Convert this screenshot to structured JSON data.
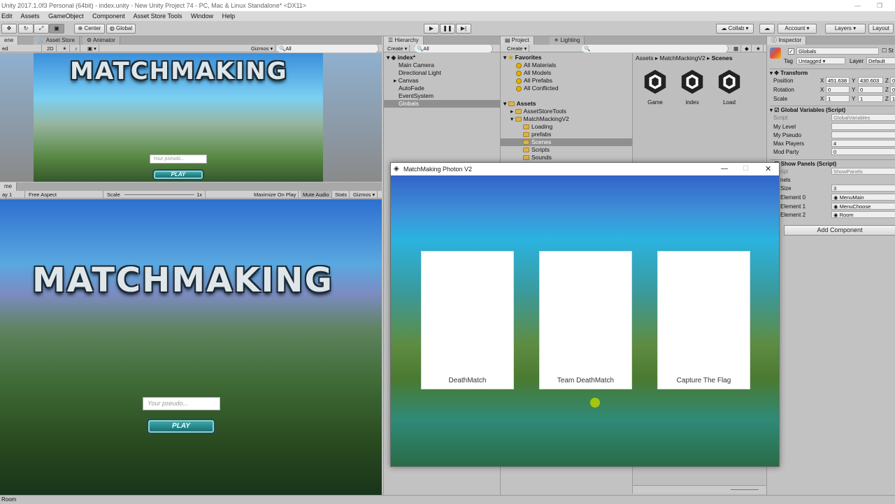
{
  "app_title": "Unity 2017.1.0f3 Personal (64bit) - index.unity - New Unity Project 74 - PC, Mac & Linux Standalone* <DX11>",
  "menu": [
    "Edit",
    "Assets",
    "GameObject",
    "Component",
    "Asset Store Tools",
    "Window",
    "Help"
  ],
  "toolbar": {
    "pivot": "Center",
    "space": "Global",
    "collab": "Collab ▾",
    "account": "Account",
    "layers": "Layers",
    "layout": "Layout"
  },
  "scene_tabs": [
    "ene",
    "Asset Store",
    "Animator"
  ],
  "scene_controls": {
    "shading": "ed",
    "mode": "2D",
    "gizmos": "Gizmos ▾",
    "search": "All"
  },
  "game_tab": "me",
  "game_controls": {
    "display": "ay 1",
    "aspect": "Free Aspect",
    "scale_label": "Scale",
    "scale_value": "1x",
    "maximize": "Maximize On Play",
    "mute": "Mute Audio",
    "stats": "Stats",
    "gizmos": "Gizmos ▾"
  },
  "matchmaking_title": "MATCHMAKING",
  "pseudo_placeholder": "Your pseudo...",
  "play_label": "PLAY",
  "hierarchy": {
    "tab": "Hierarchy",
    "create": "Create ▾",
    "search": "All",
    "scene": "index*",
    "items": [
      "Main Camera",
      "Directional Light",
      "Canvas",
      "AutoFade",
      "EventSystem",
      "Globals"
    ]
  },
  "project": {
    "tab": "Project",
    "tab2": "Lighting",
    "create": "Create ▾",
    "favorites_label": "Favorites",
    "favorites": [
      "All Materials",
      "All Models",
      "All Prefabs",
      "All Conflicted"
    ],
    "assets_label": "Assets",
    "tree": [
      "AssetStoreTools",
      "MatchMackingV2",
      "Loading",
      "prefabs",
      "Scenes",
      "Scripts",
      "Sounds"
    ],
    "breadcrumb": [
      "Assets",
      "MatchMackingV2",
      "Scenes"
    ],
    "scenes": [
      "Game",
      "index",
      "Load"
    ]
  },
  "inspector": {
    "tab": "Inspector",
    "object_name": "Globals",
    "static_label": "St",
    "tag_label": "Tag",
    "tag_value": "Untagged",
    "layer_label": "Layer",
    "layer_value": "Default",
    "transform_label": "Transform",
    "position_label": "Position",
    "pos_x": "451.638",
    "pos_y": "430.603",
    "pos_z": "0",
    "rotation_label": "Rotation",
    "rot_x": "0",
    "rot_y": "0",
    "rot_z": "0",
    "scale_label": "Scale",
    "scl_x": "1",
    "scl_y": "1",
    "scl_z": "1",
    "globalvars_label": "Global Variables (Script)",
    "script_label": "Script",
    "globalvars_script": "GlobalVariables",
    "my_level": "My Level",
    "my_pseudo": "My Pseudo",
    "max_players_label": "Max Players",
    "max_players_value": "4",
    "mod_party_label": "Mod Party",
    "mod_party_value": "0",
    "showpanels_label": "Show Panels (Script)",
    "showpanels_script_label": "ript",
    "showpanels_script": "ShowPanels",
    "panels_label": "nels",
    "size_label": "Size",
    "size_value": "3",
    "element0_label": "Element 0",
    "element0_value": "MenuMain",
    "element1_label": "Element 1",
    "element1_value": "MenuChoose",
    "element2_label": "Element 2",
    "element2_value": "Room",
    "add_component": "Add Component"
  },
  "popup_window": {
    "title": "MatchMaking Photon V2",
    "cards": [
      "DeathMatch",
      "Team DeathMatch",
      "Capture The Flag"
    ]
  },
  "status_text": "Room"
}
